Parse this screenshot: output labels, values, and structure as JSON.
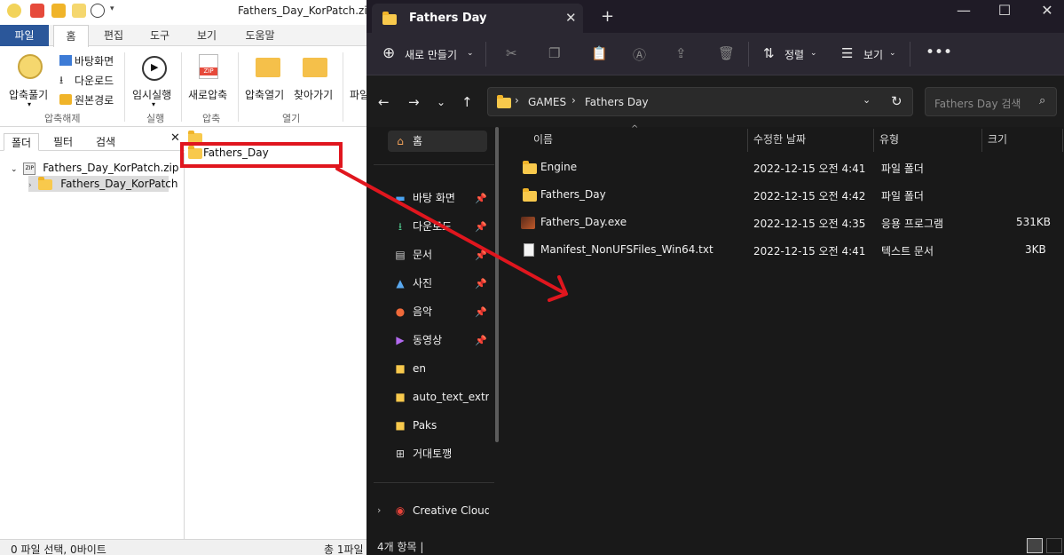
{
  "bandizip": {
    "window_title": "Fathers_Day_KorPatch.zip",
    "ribbon_tabs": [
      "파일",
      "홈",
      "편집",
      "도구",
      "보기",
      "도움말"
    ],
    "ribbon": {
      "extract_label": "압축풀기",
      "to_desktop": "바탕화면",
      "to_downloads": "다운로드",
      "to_source": "원본경로",
      "group_extract": "압축해제",
      "run_label": "임시실행",
      "group_run": "실행",
      "new_archive": "새로압축",
      "group_compress": "압축",
      "open_archive": "압축열기",
      "find": "찾아가기",
      "group_open": "열기",
      "more": "파일"
    },
    "pane_tabs": [
      "폴더",
      "필터",
      "검색"
    ],
    "tree": {
      "root": "Fathers_Day_KorPatch.zip",
      "child": "Fathers_Day_KorPatch"
    },
    "list": {
      "item": "Fathers_Day"
    },
    "status_left": "0 파일 선택,  0바이트",
    "status_right": "총 1파일"
  },
  "explorer": {
    "tab_title": "Fathers Day",
    "toolbar": {
      "new": "새로 만들기",
      "sort": "정렬",
      "view": "보기"
    },
    "breadcrumb": [
      "GAMES",
      "Fathers Day"
    ],
    "search_placeholder": "Fathers Day 검색",
    "sidebar": {
      "home": "홈",
      "items": [
        {
          "label": "바탕 화면",
          "icon": "desktop-icon",
          "pinned": true
        },
        {
          "label": "다운로드",
          "icon": "download-icon",
          "pinned": true
        },
        {
          "label": "문서",
          "icon": "document-icon",
          "pinned": true
        },
        {
          "label": "사진",
          "icon": "pictures-icon",
          "pinned": true
        },
        {
          "label": "음악",
          "icon": "music-icon",
          "pinned": true
        },
        {
          "label": "동영상",
          "icon": "video-icon",
          "pinned": true
        },
        {
          "label": "en",
          "icon": "folder-icon",
          "pinned": false
        },
        {
          "label": "auto_text_extrac",
          "icon": "folder-icon",
          "pinned": false
        },
        {
          "label": "Paks",
          "icon": "folder-icon",
          "pinned": false
        },
        {
          "label": "거대토깽",
          "icon": "grid-icon",
          "pinned": false
        }
      ],
      "creative_cloud": "Creative Cloud"
    },
    "columns": [
      "이름",
      "수정한 날짜",
      "유형",
      "크기"
    ],
    "files": [
      {
        "name": "Engine",
        "date": "2022-12-15 오전 4:41",
        "type": "파일 폴더",
        "size": "",
        "icon": "folder-icon"
      },
      {
        "name": "Fathers_Day",
        "date": "2022-12-15 오전 4:42",
        "type": "파일 폴더",
        "size": "",
        "icon": "folder-icon"
      },
      {
        "name": "Fathers_Day.exe",
        "date": "2022-12-15 오전 4:35",
        "type": "응용 프로그램",
        "size": "531KB",
        "icon": "exe-icon"
      },
      {
        "name": "Manifest_NonUFSFiles_Win64.txt",
        "date": "2022-12-15 오전 4:41",
        "type": "텍스트 문서",
        "size": "3KB",
        "icon": "text-file-icon"
      }
    ],
    "status": "4개 항목  |"
  },
  "colors": {
    "annotation_red": "#e0161e",
    "explorer_bg": "#191919",
    "folder_yellow": "#f8c94c",
    "ribbon_file_blue": "#2b579a"
  }
}
